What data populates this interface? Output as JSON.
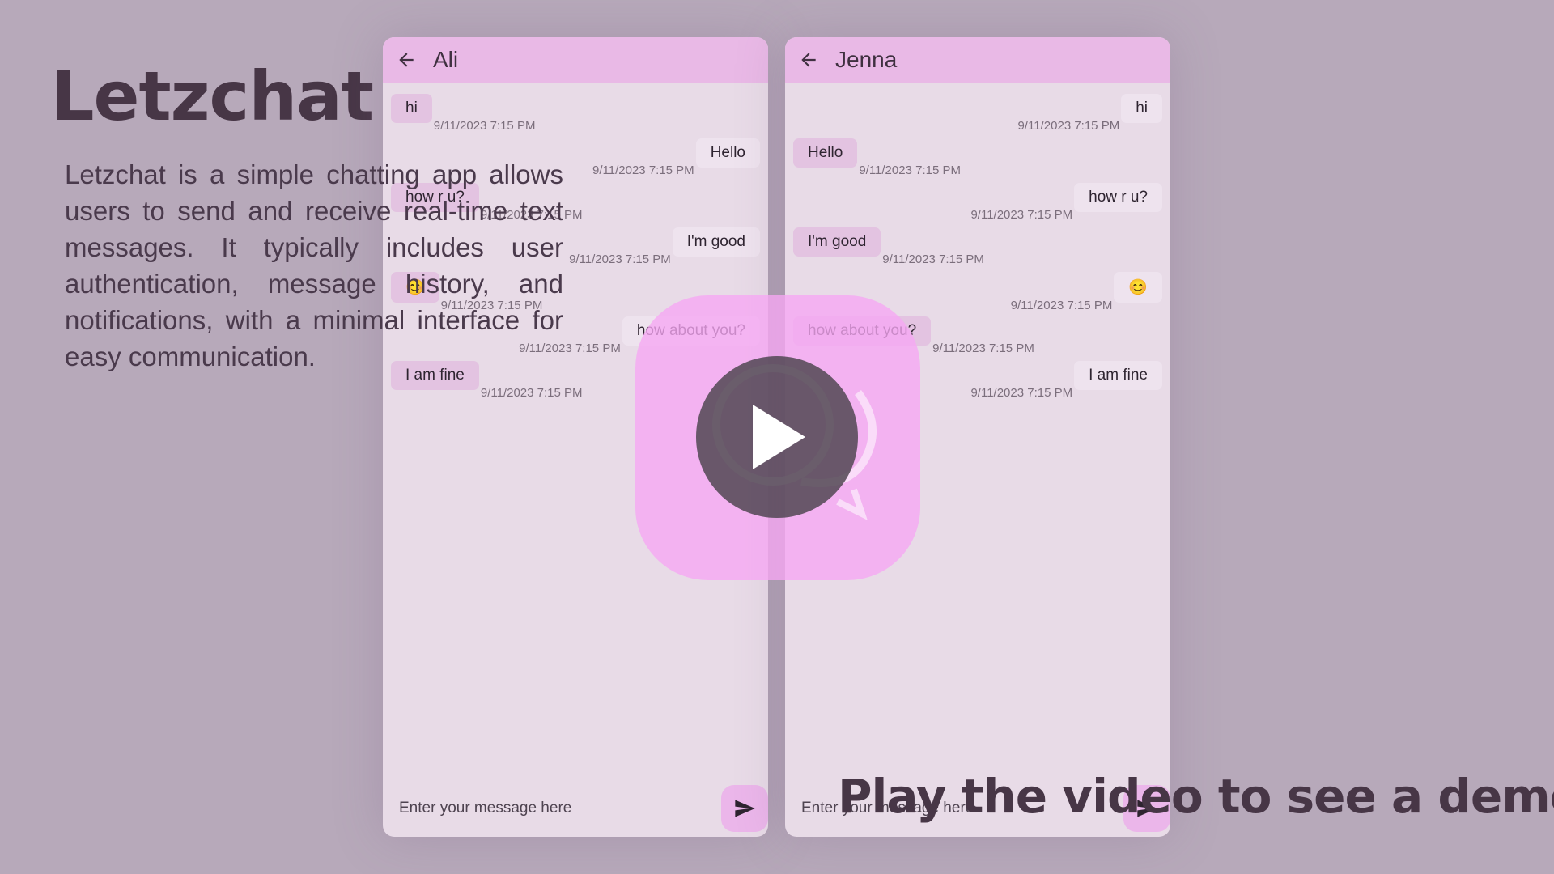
{
  "app": {
    "title": "Letzchat",
    "description": "Letzchat is a simple chatting app allows users to send and receive real-time text messages. It typically includes user authentication, message history, and notifications, with a minimal interface for easy communication.",
    "cta": "Play the video to see a demo"
  },
  "colors": {
    "background": "#b7a9ba",
    "header": "#e9b9e6",
    "accent": "#f6a6f4"
  },
  "phones": [
    {
      "contact": "Ali",
      "input_placeholder": "Enter your message here",
      "messages": [
        {
          "dir": "in",
          "text": "hi",
          "time": "9/11/2023 7:15 PM"
        },
        {
          "dir": "out",
          "text": "Hello",
          "time": "9/11/2023 7:15 PM"
        },
        {
          "dir": "in",
          "text": "how r u?",
          "time": "9/11/2023 7:15 PM"
        },
        {
          "dir": "out",
          "text": "I'm good",
          "time": "9/11/2023 7:15 PM"
        },
        {
          "dir": "in",
          "text": "😊",
          "time": "9/11/2023 7:15 PM"
        },
        {
          "dir": "out",
          "text": "how about you?",
          "time": "9/11/2023 7:15 PM"
        },
        {
          "dir": "in",
          "text": "I am fine",
          "time": "9/11/2023 7:15 PM"
        }
      ]
    },
    {
      "contact": "Jenna",
      "input_placeholder": "Enter your message here",
      "messages": [
        {
          "dir": "out",
          "text": "hi",
          "time": "9/11/2023 7:15 PM"
        },
        {
          "dir": "in",
          "text": "Hello",
          "time": "9/11/2023 7:15 PM"
        },
        {
          "dir": "out",
          "text": "how r u?",
          "time": "9/11/2023 7:15 PM"
        },
        {
          "dir": "in",
          "text": "I'm good",
          "time": "9/11/2023 7:15 PM"
        },
        {
          "dir": "out",
          "text": "😊",
          "time": "9/11/2023 7:15 PM"
        },
        {
          "dir": "in",
          "text": "how about you?",
          "time": "9/11/2023 7:15 PM"
        },
        {
          "dir": "out",
          "text": "I am fine",
          "time": "9/11/2023 7:15 PM"
        }
      ]
    }
  ],
  "icons": {
    "back": "back-arrow-icon",
    "send": "send-icon",
    "play": "play-icon",
    "logo": "chat-bubbles-icon"
  }
}
